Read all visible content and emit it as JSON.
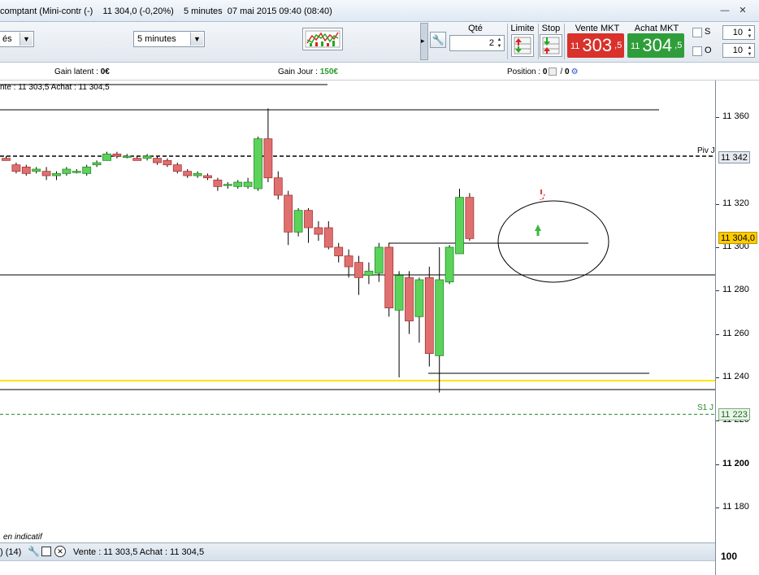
{
  "window": {
    "title": "comptant (Mini-contr (-)    11 304,0 (-0,20%)    5 minutes  07 mai 2015 09:40 (08:40)",
    "minimize_glyph": "—",
    "close_glyph": "✕"
  },
  "toolbar": {
    "left_select_value": "és",
    "timeframe_value": "5 minutes",
    "qty_label": "Qté",
    "qty_value": "2",
    "limit_label": "Limite",
    "stop_label": "Stop",
    "sell_label": "Vente MKT",
    "buy_label": "Achat MKT",
    "sell_price_prefix": "11",
    "sell_price_main": "303",
    "sell_price_sup": ",5",
    "buy_price_prefix": "11",
    "buy_price_main": "304",
    "buy_price_sup": ",5",
    "s_label": "S",
    "s_value": "10",
    "o_label": "O",
    "o_value": "10",
    "sell_color": "#d9312b",
    "buy_color": "#2f9e3a"
  },
  "infobar": {
    "latent_label": "Gain latent : ",
    "latent_value": "0€",
    "day_label": "Gain Jour : ",
    "day_value": "150€",
    "position_label": "Position : ",
    "position_value_1": "0",
    "position_value_2": "0"
  },
  "chart_overlay": {
    "top_quote": "nte : 11 303,5 Achat : 11 304,5",
    "bottom_note": "en indicatif",
    "pivot_label": "Piv J",
    "s1_label": "S1 J",
    "pivot_tag": "11 342",
    "price_tag": "11 304,0",
    "s1_tag": "11 223"
  },
  "yaxis": {
    "ticks": [
      "11 360",
      "11 320",
      "11 300",
      "11 280",
      "11 260",
      "11 240",
      "11 220",
      "11 200",
      "11 180"
    ],
    "lower_tick": "100"
  },
  "bottombar": {
    "count": ") (14)",
    "quote": "Vente : 11 303,5 Achat : 11 304,5"
  },
  "chart_data": {
    "type": "candlestick",
    "timeframe": "5 minutes",
    "yrange": [
      11160,
      11380
    ],
    "pivot": 11342,
    "s1": 11223,
    "last_price": 11304,
    "candles": [
      {
        "o": 11341,
        "h": 11342,
        "l": 11340,
        "c": 11340
      },
      {
        "o": 11338,
        "h": 11339,
        "l": 11334,
        "c": 11335
      },
      {
        "o": 11337,
        "h": 11338,
        "l": 11333,
        "c": 11334
      },
      {
        "o": 11335,
        "h": 11337,
        "l": 11334,
        "c": 11336
      },
      {
        "o": 11335,
        "h": 11337,
        "l": 11331,
        "c": 11333
      },
      {
        "o": 11333,
        "h": 11335,
        "l": 11331,
        "c": 11334
      },
      {
        "o": 11334,
        "h": 11337,
        "l": 11333,
        "c": 11336
      },
      {
        "o": 11335,
        "h": 11336,
        "l": 11334,
        "c": 11335
      },
      {
        "o": 11334,
        "h": 11338,
        "l": 11333,
        "c": 11337
      },
      {
        "o": 11338,
        "h": 11340,
        "l": 11337,
        "c": 11339
      },
      {
        "o": 11340,
        "h": 11344,
        "l": 11340,
        "c": 11343
      },
      {
        "o": 11343,
        "h": 11344,
        "l": 11341,
        "c": 11342
      },
      {
        "o": 11342,
        "h": 11343,
        "l": 11341,
        "c": 11342
      },
      {
        "o": 11341,
        "h": 11342,
        "l": 11340,
        "c": 11340
      },
      {
        "o": 11341,
        "h": 11343,
        "l": 11340,
        "c": 11342
      },
      {
        "o": 11341,
        "h": 11342,
        "l": 11338,
        "c": 11339
      },
      {
        "o": 11340,
        "h": 11341,
        "l": 11337,
        "c": 11338
      },
      {
        "o": 11338,
        "h": 11339,
        "l": 11334,
        "c": 11335
      },
      {
        "o": 11335,
        "h": 11336,
        "l": 11332,
        "c": 11333
      },
      {
        "o": 11333,
        "h": 11335,
        "l": 11332,
        "c": 11334
      },
      {
        "o": 11333,
        "h": 11334,
        "l": 11331,
        "c": 11332
      },
      {
        "o": 11331,
        "h": 11332,
        "l": 11326,
        "c": 11328
      },
      {
        "o": 11329,
        "h": 11330,
        "l": 11327,
        "c": 11329
      },
      {
        "o": 11328,
        "h": 11331,
        "l": 11327,
        "c": 11330
      },
      {
        "o": 11328,
        "h": 11332,
        "l": 11327,
        "c": 11330
      },
      {
        "o": 11327,
        "h": 11351,
        "l": 11326,
        "c": 11350
      },
      {
        "o": 11350,
        "h": 11364,
        "l": 11330,
        "c": 11332
      },
      {
        "o": 11332,
        "h": 11335,
        "l": 11322,
        "c": 11324
      },
      {
        "o": 11324,
        "h": 11326,
        "l": 11301,
        "c": 11307
      },
      {
        "o": 11307,
        "h": 11318,
        "l": 11305,
        "c": 11317
      },
      {
        "o": 11317,
        "h": 11318,
        "l": 11302,
        "c": 11309
      },
      {
        "o": 11309,
        "h": 11312,
        "l": 11303,
        "c": 11306
      },
      {
        "o": 11309,
        "h": 11312,
        "l": 11299,
        "c": 11300
      },
      {
        "o": 11300,
        "h": 11302,
        "l": 11293,
        "c": 11296
      },
      {
        "o": 11296,
        "h": 11299,
        "l": 11286,
        "c": 11291
      },
      {
        "o": 11293,
        "h": 11296,
        "l": 11278,
        "c": 11286
      },
      {
        "o": 11287,
        "h": 11293,
        "l": 11283,
        "c": 11289
      },
      {
        "o": 11288,
        "h": 11302,
        "l": 11284,
        "c": 11300
      },
      {
        "o": 11300,
        "h": 11302,
        "l": 11268,
        "c": 11272
      },
      {
        "o": 11271,
        "h": 11289,
        "l": 11240,
        "c": 11287
      },
      {
        "o": 11286,
        "h": 11289,
        "l": 11260,
        "c": 11266
      },
      {
        "o": 11268,
        "h": 11286,
        "l": 11256,
        "c": 11285
      },
      {
        "o": 11286,
        "h": 11291,
        "l": 11245,
        "c": 11251
      },
      {
        "o": 11250,
        "h": 11300,
        "l": 11233,
        "c": 11285
      },
      {
        "o": 11284,
        "h": 11301,
        "l": 11283,
        "c": 11300
      },
      {
        "o": 11297,
        "h": 11327,
        "l": 11297,
        "c": 11323
      },
      {
        "o": 11323,
        "h": 11325,
        "l": 11303,
        "c": 11304
      }
    ]
  }
}
